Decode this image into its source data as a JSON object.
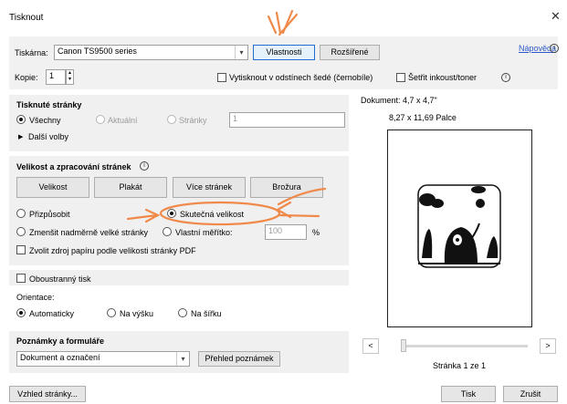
{
  "window": {
    "title": "Tisknout"
  },
  "printer": {
    "label": "Tiskárna:",
    "value": "Canon TS9500 series",
    "properties_label": "Vlastnosti",
    "advanced_label": "Rozšířené",
    "help_label": "Nápověda"
  },
  "copies": {
    "label": "Kopie:",
    "value": "1"
  },
  "options": {
    "grayscale_label": "Vytisknout v odstínech šedé (černobíle)",
    "save_ink_label": "Šetřit inkoust/toner"
  },
  "pages": {
    "heading": "Tisknuté stránky",
    "all_label": "Všechny",
    "current_label": "Aktuální",
    "pages_label": "Stránky",
    "pages_value": "1",
    "more_label": "Další volby"
  },
  "sizing": {
    "heading": "Velikost a zpracování stránek",
    "buttons": [
      "Velikost",
      "Plakát",
      "Více stránek",
      "Brožura"
    ],
    "fit_label": "Přizpůsobit",
    "actual_label": "Skutečná velikost",
    "shrink_label": "Zmenšit nadměrně velké stránky",
    "custom_label": "Vlastní měřítko:",
    "custom_value": "100",
    "percent": "%",
    "paper_source_label": "Zvolit zdroj papíru podle velikosti stránky PDF"
  },
  "duplex": {
    "label": "Oboustranný tisk"
  },
  "orientation": {
    "label": "Orientace:",
    "auto_label": "Automaticky",
    "portrait_label": "Na výšku",
    "landscape_label": "Na šířku"
  },
  "comments": {
    "heading": "Poznámky a formuláře",
    "value": "Dokument a označení",
    "summary_label": "Přehled poznámek"
  },
  "preview": {
    "document_label": "Dokument: 4,7 x 4,7\"",
    "paper_size": "8,27 x 11,69 Palce",
    "prev": "<",
    "next": ">",
    "page_label": "Stránka 1 ze 1"
  },
  "footer": {
    "page_setup_label": "Vzhled stránky...",
    "print_label": "Tisk",
    "cancel_label": "Zrušit"
  },
  "colors": {
    "accent": "#1f6fd1",
    "annotation": "#f08a4b",
    "panel": "#f0f0f0"
  }
}
